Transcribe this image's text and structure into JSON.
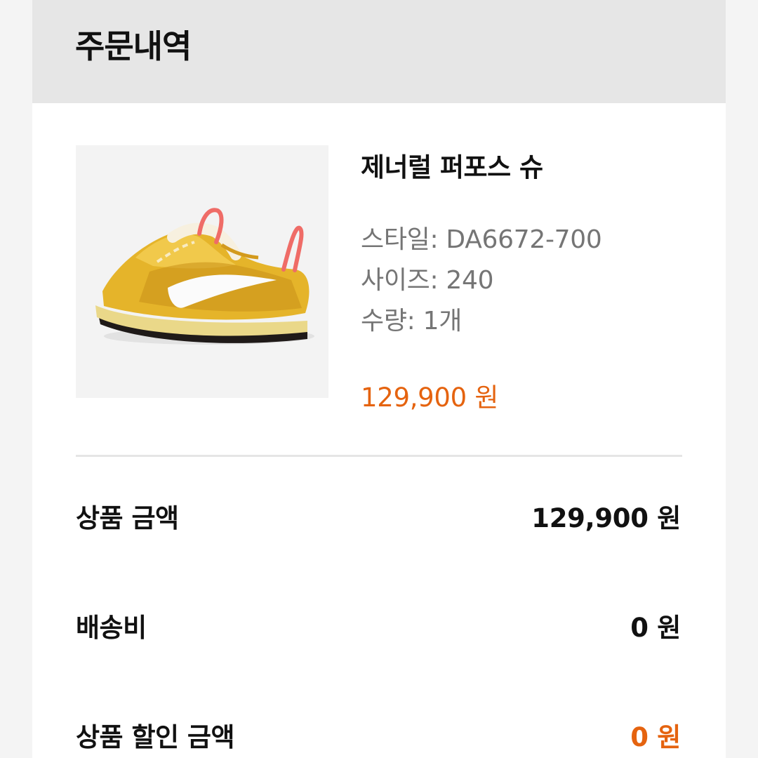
{
  "header": {
    "title": "주문내역"
  },
  "product": {
    "name": "제너럴 퍼포스 슈",
    "style_line": "스타일: DA6672-700",
    "size_line": "사이즈: 240",
    "quantity_line": "수량: 1개",
    "price": "129,900 원",
    "image_icon": "yellow-sneaker-image"
  },
  "summary": {
    "product_amount_label": "상품 금액",
    "product_amount_value": "129,900 원",
    "shipping_label": "배송비",
    "shipping_value": "0 원",
    "discount_label": "상품 할인 금액",
    "discount_value": "0 원"
  },
  "colors": {
    "accent": "#e5630f",
    "header_bg": "#e6e6e6",
    "text_primary": "#111111",
    "text_secondary": "#757575"
  }
}
